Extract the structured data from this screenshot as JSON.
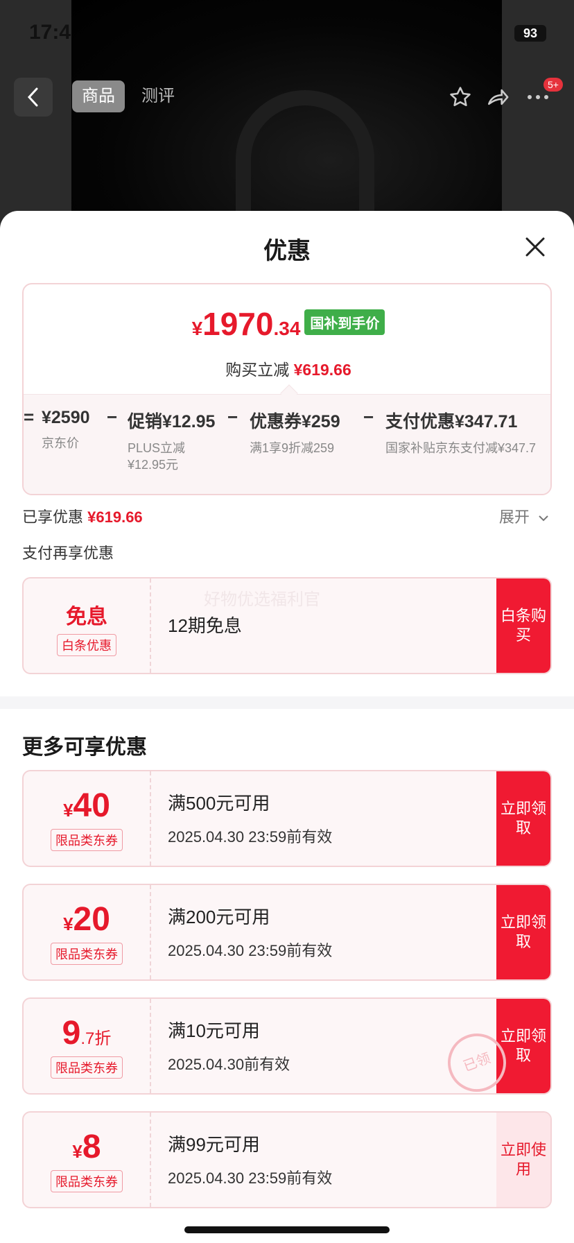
{
  "status_bar": {
    "time": "17:4",
    "battery": "93"
  },
  "nav": {
    "tabs": [
      "商品",
      "测评"
    ],
    "badge": "5+"
  },
  "sheet": {
    "title": "优惠",
    "price": {
      "currency": "¥",
      "integer": "1970",
      "decimal": ".34",
      "tag": "国补到手价"
    },
    "saving": {
      "label": "购买立减",
      "amount": "¥619.66"
    },
    "breakdown": [
      {
        "op": "=",
        "amount": "¥2590",
        "note": "京东价"
      },
      {
        "op": "−",
        "amount": "促销¥12.95",
        "note": "PLUS立减 ¥12.95元"
      },
      {
        "op": "−",
        "amount": "优惠券¥259",
        "note": "满1享9折减259"
      },
      {
        "op": "−",
        "amount": "支付优惠¥347.71",
        "note": "国家补贴京东支付减¥347.7"
      }
    ],
    "enjoyed": {
      "label": "已享优惠",
      "amount": "¥619.66"
    },
    "expand_label": "展开",
    "pay_more_label": "支付再享优惠",
    "interest_free": {
      "main": "免息",
      "type": "白条优惠",
      "desc": "12期免息",
      "watermark": "好物优选福利官",
      "button": "白条购买"
    },
    "more_title": "更多可享优惠",
    "coupons": [
      {
        "amount": "40",
        "type": "限品类东券",
        "condition": "满500元可用",
        "expiry": "2025.04.30 23:59前有效",
        "button": "立即领取"
      },
      {
        "amount": "20",
        "type": "限品类东券",
        "condition": "满200元可用",
        "expiry": "2025.04.30 23:59前有效",
        "button": "立即领取"
      },
      {
        "amount": "9",
        "amount_decimal": ".7折",
        "type": "限品类东券",
        "condition": "满10元可用",
        "expiry": "2025.04.30前有效",
        "button": "立即领取"
      },
      {
        "amount": "8",
        "type": "限品类东券",
        "condition": "满99元可用",
        "expiry": "2025.04.30 23:59前有效",
        "button": "立即使用"
      }
    ],
    "stamp": "已领"
  },
  "colors": {
    "accent_red": "#f01a32",
    "tag_green": "#3fae49"
  }
}
